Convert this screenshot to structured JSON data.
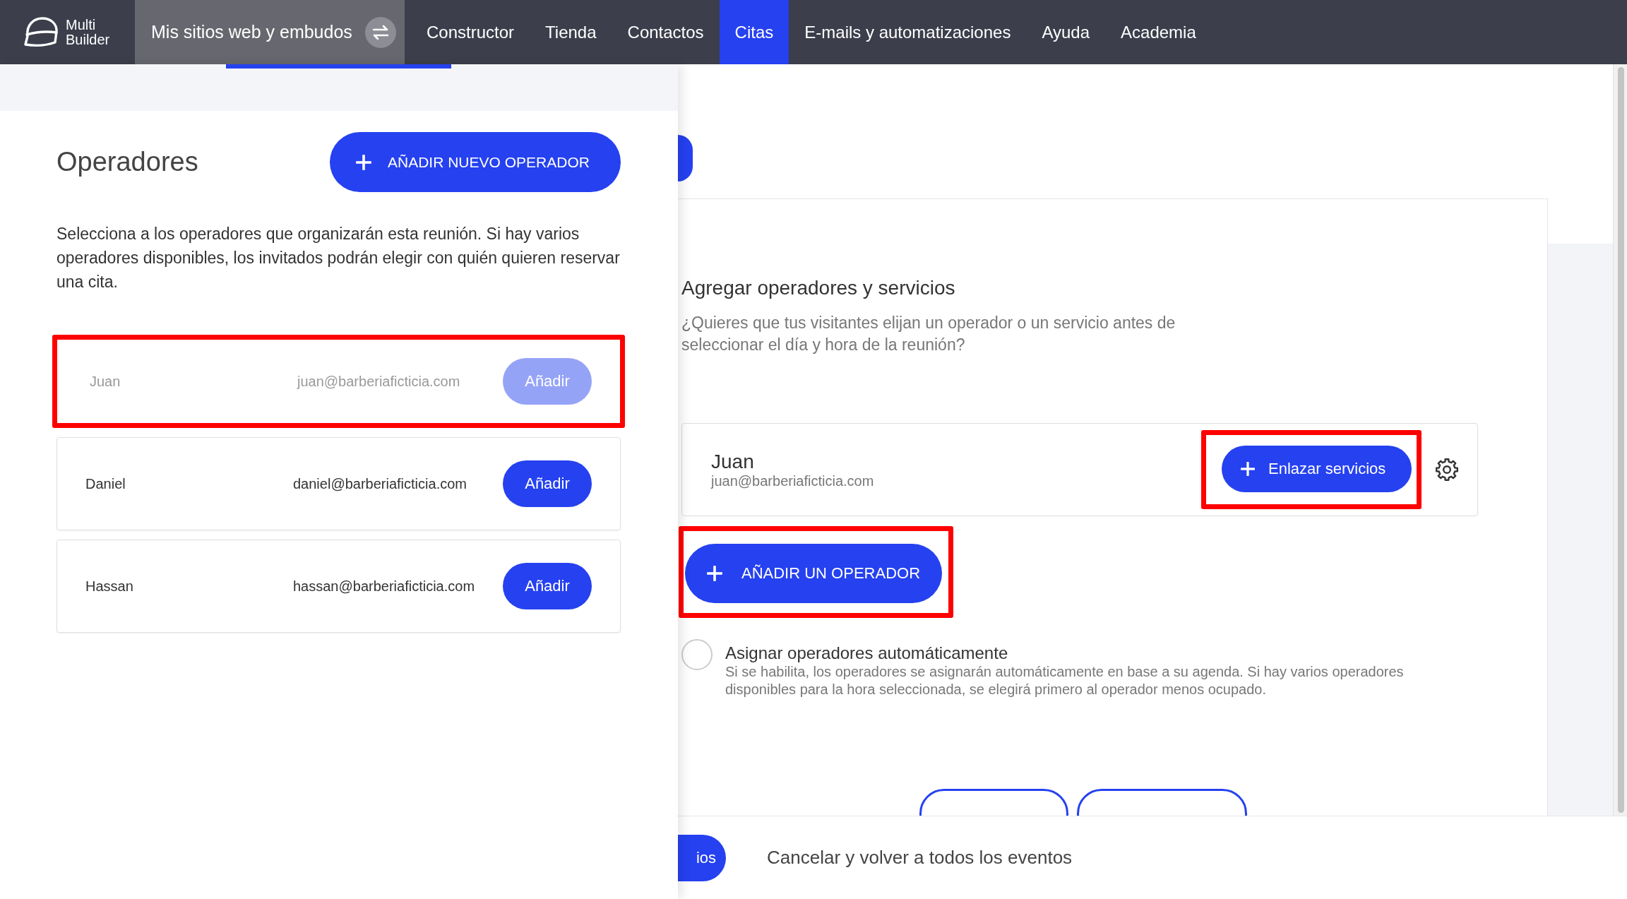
{
  "nav": {
    "logo_text": [
      "Multi",
      "Builder"
    ],
    "site_switcher": {
      "label": "Mis sitios web y embudos"
    },
    "items": [
      {
        "label": "Constructor",
        "selected": false
      },
      {
        "label": "Tienda",
        "selected": false
      },
      {
        "label": "Contactos",
        "selected": false
      },
      {
        "label": "Citas",
        "selected": true
      },
      {
        "label": "E-mails y automatizaciones",
        "selected": false
      },
      {
        "label": "Ayuda",
        "selected": false
      },
      {
        "label": "Academia",
        "selected": false
      }
    ]
  },
  "drawer": {
    "title": "Operadores",
    "add_button": "AÑADIR NUEVO OPERADOR",
    "description": "Selecciona a los operadores que organizarán esta reunión. Si hay varios operadores disponibles, los invitados podrán elegir con quién quieren reservar una cita.",
    "operators": [
      {
        "name": "Juan",
        "email": "juan@barberiaficticia.com",
        "button": "Añadir",
        "disabled": true,
        "highlighted": true
      },
      {
        "name": "Daniel",
        "email": "daniel@barberiaficticia.com",
        "button": "Añadir",
        "disabled": false,
        "highlighted": false
      },
      {
        "name": "Hassan",
        "email": "hassan@barberiaficticia.com",
        "button": "Añadir",
        "disabled": false,
        "highlighted": false
      }
    ]
  },
  "main": {
    "title": "Agregar operadores y servicios",
    "description": "¿Quieres que tus visitantes elijan un operador o un servicio antes de seleccionar el día y hora de la reunión?",
    "operators": [
      {
        "name": "Juan",
        "email": "juan@barberiaficticia.com",
        "button": "Enlazar servicios",
        "highlighted": true
      }
    ],
    "add_operator": {
      "label": "AÑADIR UN OPERADOR",
      "highlighted": true
    },
    "auto_assign": {
      "label": "Asignar operadores automáticamente",
      "description": "Si se habilita, los operadores se asignarán automáticamente en base a su agenda. Si hay varios operadores disponibles para la hora seleccionada, se elegirá primero al operador menos ocupado.",
      "checked": false
    }
  },
  "footer": {
    "save_button": "ios",
    "cancel_link": "Cancelar y volver a todos los eventos"
  }
}
